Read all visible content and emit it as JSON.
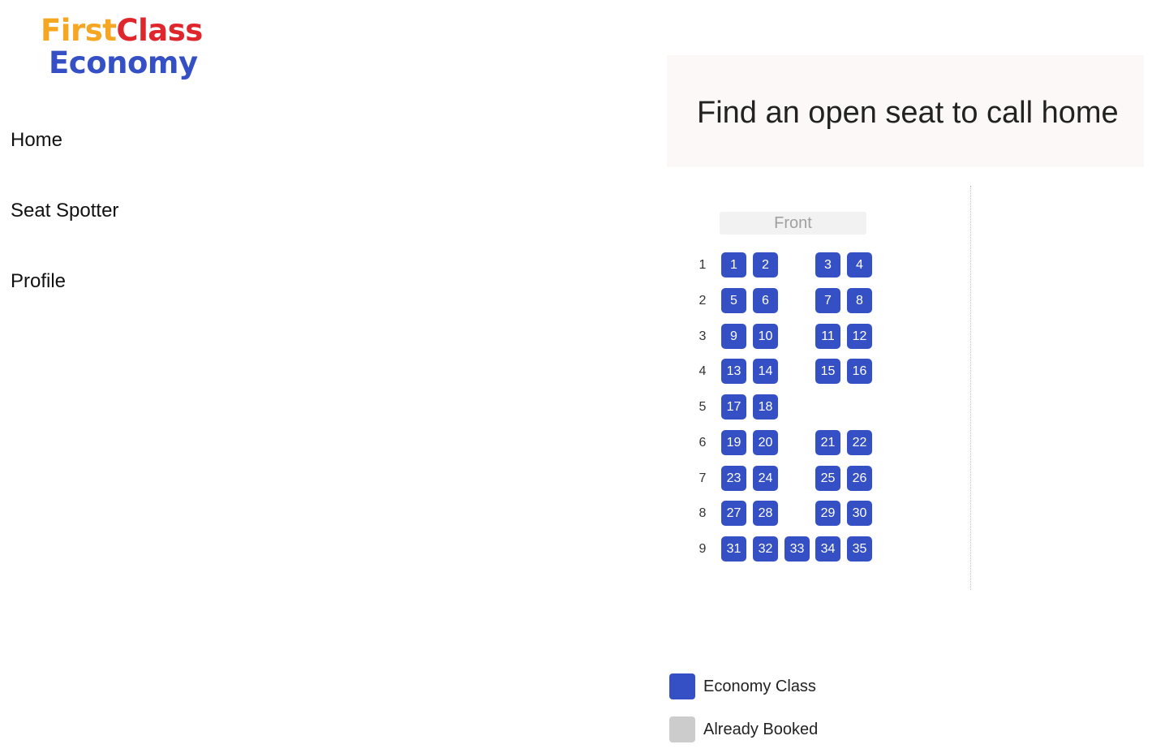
{
  "logo": {
    "first": "First",
    "class": "Class",
    "economy": "Economy"
  },
  "nav": {
    "items": [
      {
        "label": "Home"
      },
      {
        "label": "Seat Spotter"
      },
      {
        "label": "Profile"
      }
    ]
  },
  "banner": {
    "title": "Find an open seat to call home"
  },
  "seat_map": {
    "front_label": "Front",
    "rows": [
      {
        "label": "1",
        "seats": [
          "1",
          "2",
          null,
          "3",
          "4"
        ]
      },
      {
        "label": "2",
        "seats": [
          "5",
          "6",
          null,
          "7",
          "8"
        ]
      },
      {
        "label": "3",
        "seats": [
          "9",
          "10",
          null,
          "11",
          "12"
        ]
      },
      {
        "label": "4",
        "seats": [
          "13",
          "14",
          null,
          "15",
          "16"
        ]
      },
      {
        "label": "5",
        "seats": [
          "17",
          "18",
          null,
          null,
          null
        ]
      },
      {
        "label": "6",
        "seats": [
          "19",
          "20",
          null,
          "21",
          "22"
        ]
      },
      {
        "label": "7",
        "seats": [
          "23",
          "24",
          null,
          "25",
          "26"
        ]
      },
      {
        "label": "8",
        "seats": [
          "27",
          "28",
          null,
          "29",
          "30"
        ]
      },
      {
        "label": "9",
        "seats": [
          "31",
          "32",
          "33",
          "34",
          "35"
        ]
      }
    ]
  },
  "legend": {
    "items": [
      {
        "label": "Economy Class",
        "color": "#3550c4"
      },
      {
        "label": "Already Booked",
        "color": "#cccccc"
      }
    ]
  }
}
